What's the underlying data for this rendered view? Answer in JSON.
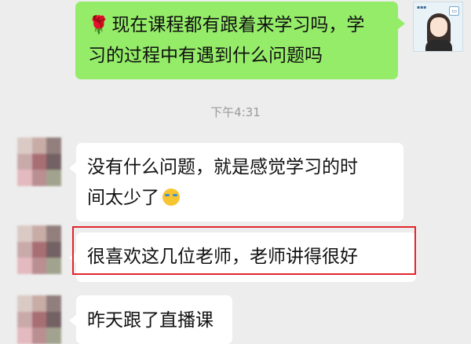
{
  "messages": [
    {
      "id": "msg-1",
      "direction": "outgoing",
      "prefix_icon": "rose-icon",
      "lines": [
        "现在课程都有跟着来学习吗，学",
        "习的过程中有遇到什么问题吗"
      ]
    },
    {
      "id": "msg-2",
      "direction": "incoming",
      "lines": [
        "没有什么问题，就是感觉学习的时",
        "间太少了"
      ],
      "suffix_icon": "crying-emoji-icon"
    },
    {
      "id": "msg-3",
      "direction": "incoming",
      "lines": [
        "很喜欢这几位老师，老师讲得很好"
      ],
      "highlighted": true
    },
    {
      "id": "msg-4",
      "direction": "incoming",
      "lines": [
        "昨天跟了直播课"
      ]
    }
  ],
  "timestamp": "下午4:31",
  "colors": {
    "background": "#ededed",
    "outgoing_bubble": "#95ec69",
    "incoming_bubble": "#ffffff",
    "highlight": "#e0262c",
    "timestamp_text": "#9a9a9a"
  },
  "avatar_blur_tiles": [
    [
      "#d9c9c4",
      "#c7a9a3",
      "#8e7a78"
    ],
    [
      "#c8a7a8",
      "#a4696e",
      "#6e5a5c"
    ],
    [
      "#e3b8bd",
      "#b88a8e",
      "#9fa08a"
    ]
  ]
}
